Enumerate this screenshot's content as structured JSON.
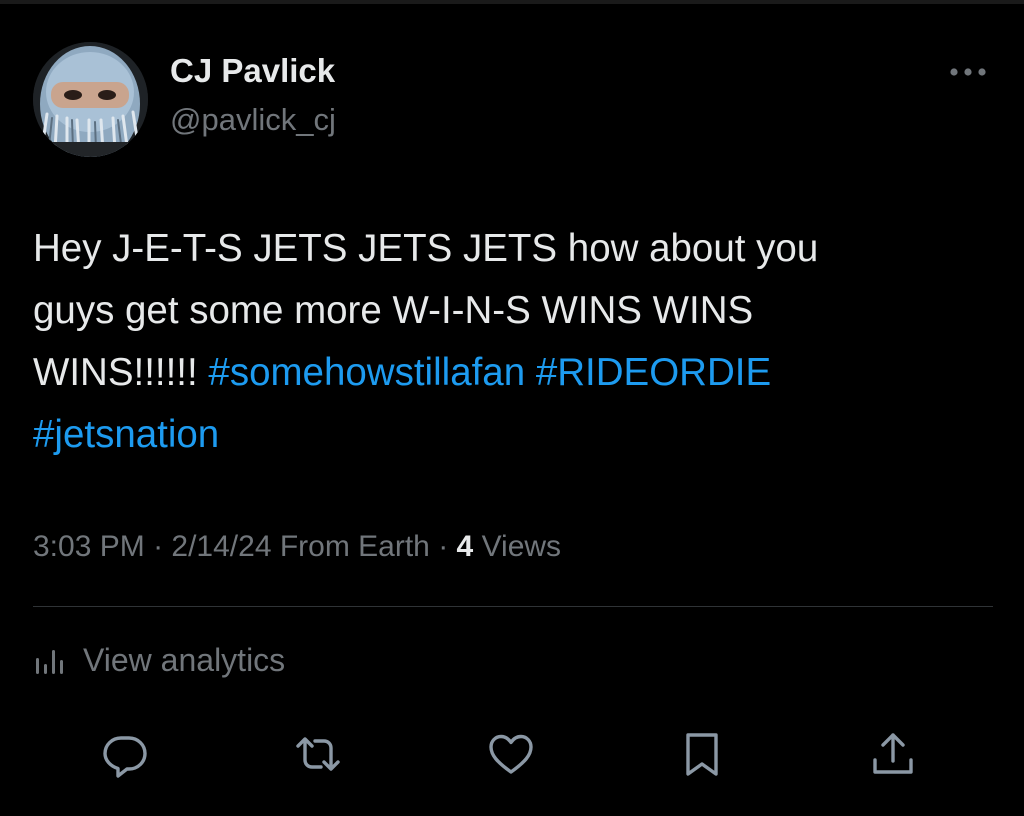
{
  "tweet": {
    "author": {
      "display_name": "CJ Pavlick",
      "handle": "@pavlick_cj",
      "avatar_icon": "avatar-photo"
    },
    "text": {
      "line1": "Hey J-E-T-S JETS JETS JETS how about you",
      "line2": "guys get some more W-I-N-S WINS WINS",
      "line3_plain": "WINS!!!!!! ",
      "hashtags": [
        "#somehowstillafan",
        "#RIDEORDIE",
        "#jetsnation"
      ]
    },
    "meta": {
      "time": "3:03 PM",
      "separator": " · ",
      "date": "2/14/24",
      "source": " From Earth",
      "views_count": "4",
      "views_label": " Views"
    },
    "analytics": {
      "label": "View analytics",
      "icon": "analytics-bars-icon"
    },
    "actions": [
      {
        "name": "reply",
        "icon": "reply-icon"
      },
      {
        "name": "retweet",
        "icon": "retweet-icon"
      },
      {
        "name": "like",
        "icon": "heart-icon"
      },
      {
        "name": "bookmark",
        "icon": "bookmark-icon"
      },
      {
        "name": "share",
        "icon": "share-icon"
      }
    ],
    "more_icon": "more-dots-icon"
  },
  "colors": {
    "background": "#000000",
    "text_primary": "#e7e9ea",
    "text_secondary": "#71767b",
    "link": "#1d9bf0",
    "divider": "#2f3336"
  }
}
